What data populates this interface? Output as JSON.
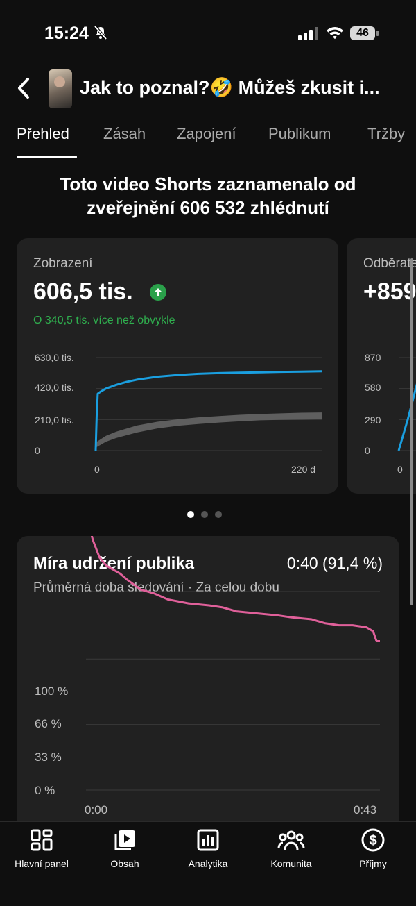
{
  "status_bar": {
    "time": "15:24",
    "battery": "46"
  },
  "header": {
    "title": "Jak to poznal?🤣 Můžeš zkusit i..."
  },
  "tabs": [
    "Přehled",
    "Zásah",
    "Zapojení",
    "Publikum",
    "Tržby"
  ],
  "summary": {
    "line1": "Toto video Shorts zaznamenalo od",
    "line2": "zveřejnění 606 532 zhlédnutí"
  },
  "views_card": {
    "label": "Zobrazení",
    "value": "606,5 tis.",
    "note": "O 340,5 tis. více než obvykle",
    "y_ticks": [
      "630,0 tis.",
      "420,0 tis.",
      "210,0 tis.",
      "0"
    ],
    "x_ticks": [
      "0",
      "220 d"
    ]
  },
  "subs_card": {
    "label": "Odběratelé",
    "value": "+859",
    "y_ticks": [
      "870",
      "580",
      "290",
      "0"
    ],
    "x_ticks": [
      "0"
    ]
  },
  "retention_card": {
    "title": "Míra udržení publika",
    "value": "0:40 (91,4 %)",
    "subtitle": "Průměrná doba sledování · Za celou dobu",
    "y_ticks": [
      "100 %",
      "66 %",
      "33 %",
      "0 %"
    ],
    "x_ticks": [
      "0:00",
      "0:43"
    ]
  },
  "bottom_nav": [
    "Hlavní panel",
    "Obsah",
    "Analytika",
    "Komunita",
    "Příjmy"
  ],
  "colors": {
    "views_line": "#1a9fe0",
    "typical_band": "#5f5f5f",
    "retention_line": "#e0609a",
    "up_badge": "#2aa04a",
    "note_green": "#2fae4e"
  },
  "chart_data": [
    {
      "type": "line",
      "title": "Zobrazení",
      "xlabel": "",
      "ylabel": "",
      "x_unit": "days",
      "xlim": [
        0,
        220
      ],
      "ylim": [
        0,
        630000
      ],
      "grid": true,
      "series": [
        {
          "x": [
            0,
            1,
            2,
            5,
            10,
            20,
            30,
            40,
            60,
            80,
            100,
            120,
            140,
            160,
            180,
            200,
            220
          ],
          "y": [
            0,
            240000,
            385000,
            400000,
            420000,
            445000,
            465000,
            480000,
            500000,
            512000,
            520000,
            525000,
            528000,
            530000,
            533000,
            535000,
            537000
          ]
        },
        {
          "x": [
            0,
            10,
            20,
            40,
            60,
            80,
            100,
            120,
            140,
            160,
            180,
            200,
            220
          ],
          "y": [
            45000,
            82000,
            110000,
            150000,
            175000,
            192000,
            205000,
            215000,
            222000,
            228000,
            233000,
            236000,
            238000
          ]
        }
      ],
      "band": {
        "x": [
          0,
          10,
          20,
          40,
          60,
          80,
          100,
          120,
          140,
          160,
          180,
          200,
          220
        ],
        "low": [
          20000,
          60000,
          85000,
          122000,
          150000,
          168000,
          180000,
          190000,
          198000,
          205000,
          208000,
          210000,
          212000
        ],
        "high": [
          55000,
          100000,
          128000,
          170000,
          195000,
          212000,
          225000,
          234000,
          242000,
          248000,
          252000,
          256000,
          258000
        ]
      }
    },
    {
      "type": "line",
      "title": "Odběratelé",
      "x_unit": "days",
      "xlim": [
        0,
        220
      ],
      "ylim": [
        0,
        870
      ],
      "grid": true,
      "series": [
        {
          "x": [
            0,
            2,
            4,
            6,
            10,
            20,
            40
          ],
          "y": [
            0,
            300,
            640,
            700,
            720,
            730,
            735
          ]
        }
      ]
    },
    {
      "type": "line",
      "title": "Míra udržení publika",
      "x_unit": "seconds",
      "xlim": [
        0,
        43
      ],
      "ylim": [
        0,
        100
      ],
      "grid": true,
      "series": [
        {
          "x": [
            0,
            0.5,
            1,
            2,
            3,
            4,
            5,
            6,
            8,
            10,
            12,
            15,
            18,
            20,
            22,
            25,
            28,
            30,
            33,
            35,
            37,
            39,
            41,
            42,
            42.5,
            43
          ],
          "y": [
            137,
            133,
            126,
            117,
            113,
            111,
            109,
            106,
            101,
            99,
            96,
            94,
            93,
            92,
            90,
            89,
            88,
            87,
            86,
            84,
            83,
            83,
            82,
            80,
            75,
            75
          ]
        }
      ]
    }
  ]
}
